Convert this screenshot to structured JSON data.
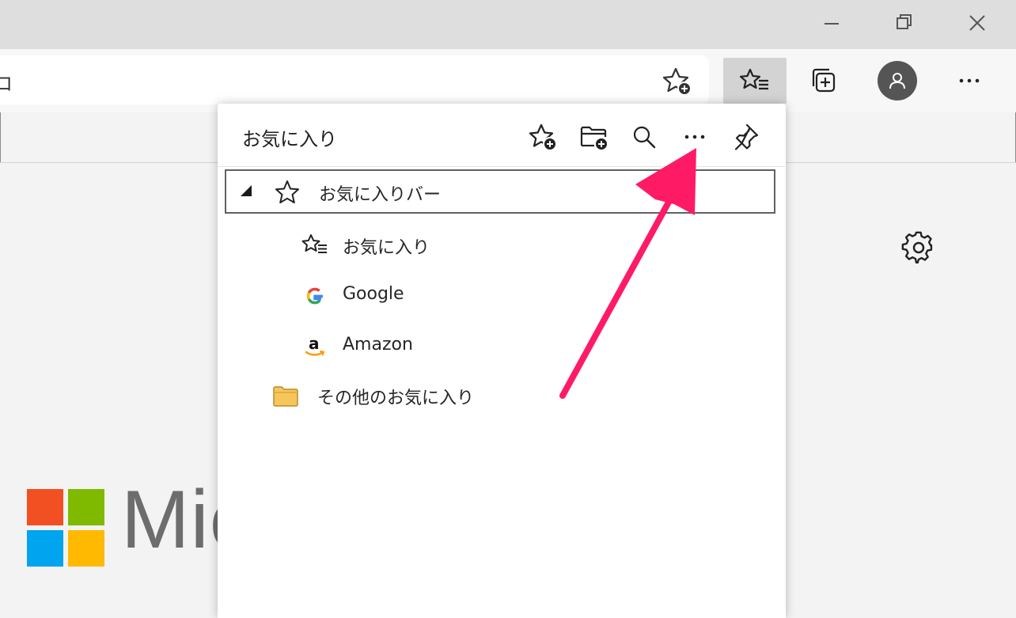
{
  "address_bar": {
    "visible_text": "ロ"
  },
  "panel": {
    "title": "お気に入り",
    "folder_bar": {
      "label": "お気に入りバー"
    },
    "items": [
      {
        "label": "お気に入り",
        "icon": "favorites-list-icon"
      },
      {
        "label": "Google",
        "icon": "google-icon"
      },
      {
        "label": "Amazon",
        "icon": "amazon-icon"
      }
    ],
    "other_folder": {
      "label": "その他のお気に入り"
    }
  },
  "page_logo": {
    "text": "Mic"
  },
  "colors": {
    "annotation_arrow": "#ff1a66",
    "folder": "#f6c65b",
    "ms_red": "#f25022",
    "ms_green": "#7fba00",
    "ms_blue": "#00a4ef",
    "ms_yellow": "#ffb900"
  }
}
